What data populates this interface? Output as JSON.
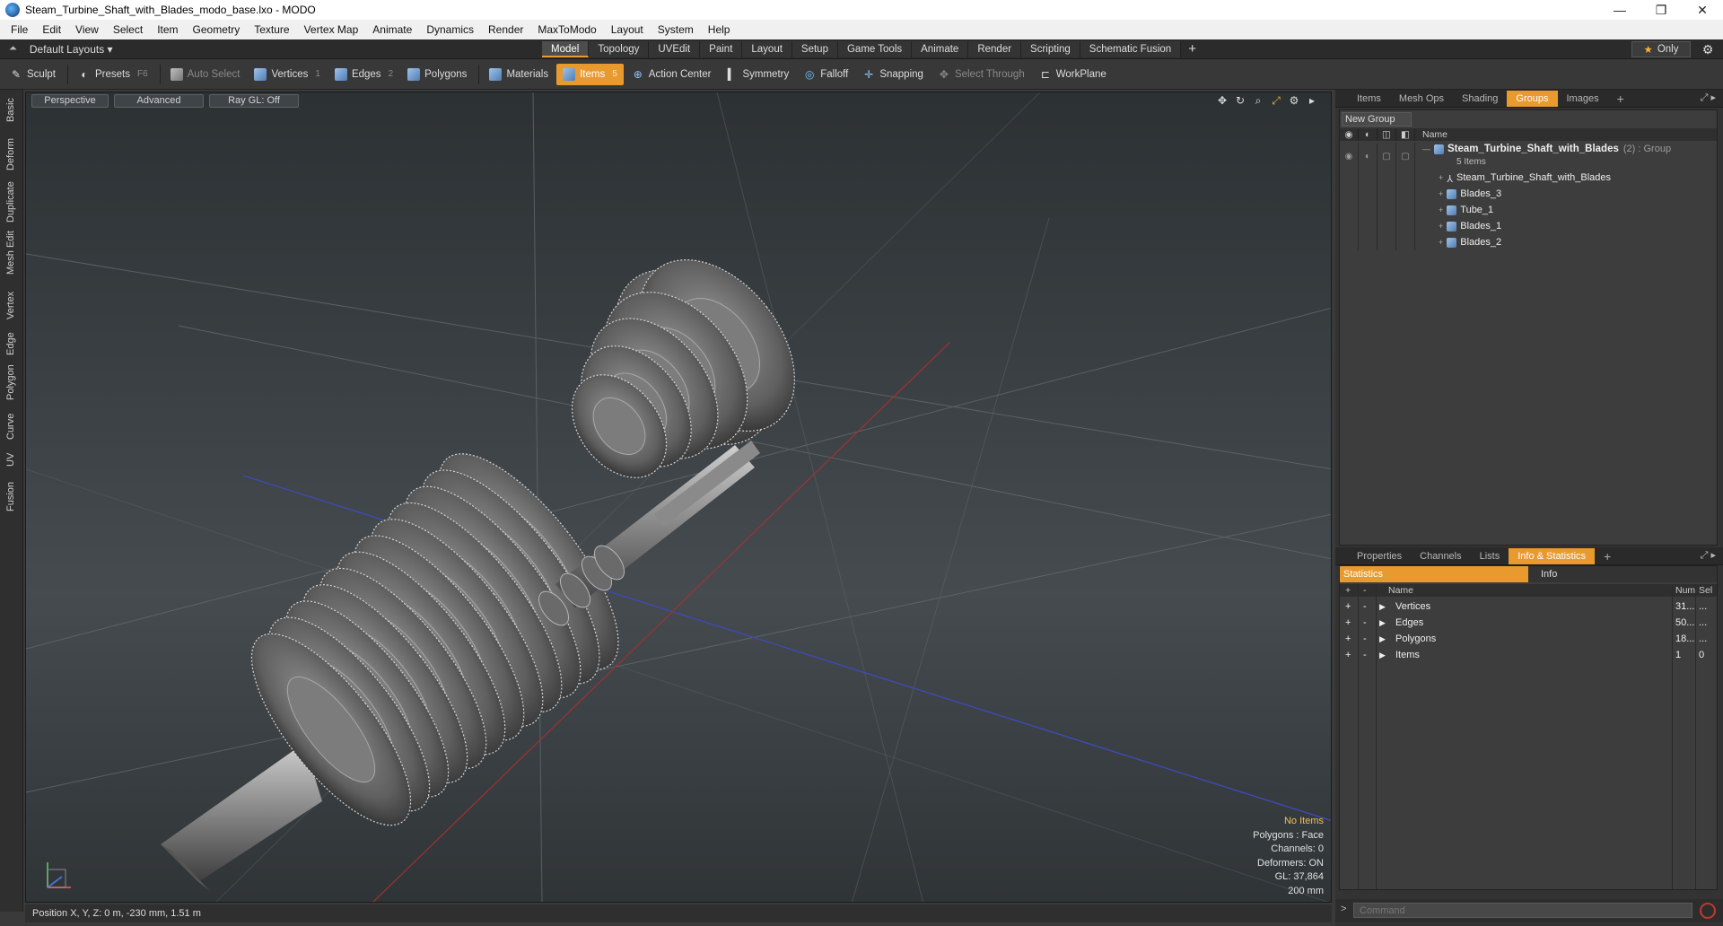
{
  "window": {
    "title": "Steam_Turbine_Shaft_with_Blades_modo_base.lxo - MODO",
    "minimize": "—",
    "maximize": "❐",
    "close": "✕"
  },
  "menu": [
    "File",
    "Edit",
    "View",
    "Select",
    "Item",
    "Geometry",
    "Texture",
    "Vertex Map",
    "Animate",
    "Dynamics",
    "Render",
    "MaxToModo",
    "Layout",
    "System",
    "Help"
  ],
  "layout_selector": "Default Layouts ▾",
  "mode_tabs": [
    "Model",
    "Topology",
    "UVEdit",
    "Paint",
    "Layout",
    "Setup",
    "Game Tools",
    "Animate",
    "Render",
    "Scripting",
    "Schematic Fusion"
  ],
  "active_mode_tab": "Model",
  "only_button": "Only",
  "toolbar": {
    "sculpt": "Sculpt",
    "presets": "Presets",
    "presets_key": "F6",
    "auto_select": "Auto Select",
    "vertices": "Vertices",
    "vertices_key": "1",
    "edges": "Edges",
    "edges_key": "2",
    "polygons": "Polygons",
    "materials": "Materials",
    "items": "Items",
    "items_key": "5",
    "action_center": "Action Center",
    "symmetry": "Symmetry",
    "falloff": "Falloff",
    "snapping": "Snapping",
    "select_through": "Select Through",
    "workplane": "WorkPlane"
  },
  "left_tabs": [
    "Basic",
    "Deform",
    "Duplicate",
    "Mesh Edit",
    "Vertex",
    "Edge",
    "Polygon",
    "Curve",
    "UV",
    "Fusion"
  ],
  "viewport": {
    "view": "Perspective",
    "shading": "Advanced",
    "raygl": "Ray GL: Off",
    "info": {
      "selection": "No Items",
      "polygons": "Polygons : Face",
      "channels": "Channels: 0",
      "deformers": "Deformers: ON",
      "gl": "GL: 37,864",
      "scale": "200 mm"
    }
  },
  "status_bar": "Position X, Y, Z:  0 m, -230 mm, 1.51 m",
  "top_panel": {
    "tabs": [
      "Items",
      "Mesh Ops",
      "Shading",
      "Groups",
      "Images"
    ],
    "active_tab": "Groups",
    "new_group": "New Group",
    "name_header": "Name",
    "group": {
      "name": "Steam_Turbine_Shaft_with_Blades",
      "meta": "(2) : Group",
      "count": "5 Items"
    },
    "items": [
      "Steam_Turbine_Shaft_with_Blades",
      "Blades_3",
      "Tube_1",
      "Blades_1",
      "Blades_2"
    ]
  },
  "bottom_panel": {
    "tabs": [
      "Properties",
      "Channels",
      "Lists",
      "Info & Statistics"
    ],
    "active_tab": "Info & Statistics",
    "subtabs": [
      "Statistics",
      "Info"
    ],
    "headers": {
      "name": "Name",
      "num": "Num",
      "sel": "Sel"
    },
    "rows": [
      {
        "name": "Vertices",
        "num": "31...",
        "sel": "..."
      },
      {
        "name": "Edges",
        "num": "50...",
        "sel": "..."
      },
      {
        "name": "Polygons",
        "num": "18...",
        "sel": "..."
      },
      {
        "name": "Items",
        "num": "1",
        "sel": "0"
      }
    ]
  },
  "command": {
    "prompt": ">",
    "placeholder": "Command"
  },
  "colors": {
    "accent": "#e89a2f",
    "viewport_top": "#2c3134",
    "viewport_mid": "#454b4f"
  }
}
